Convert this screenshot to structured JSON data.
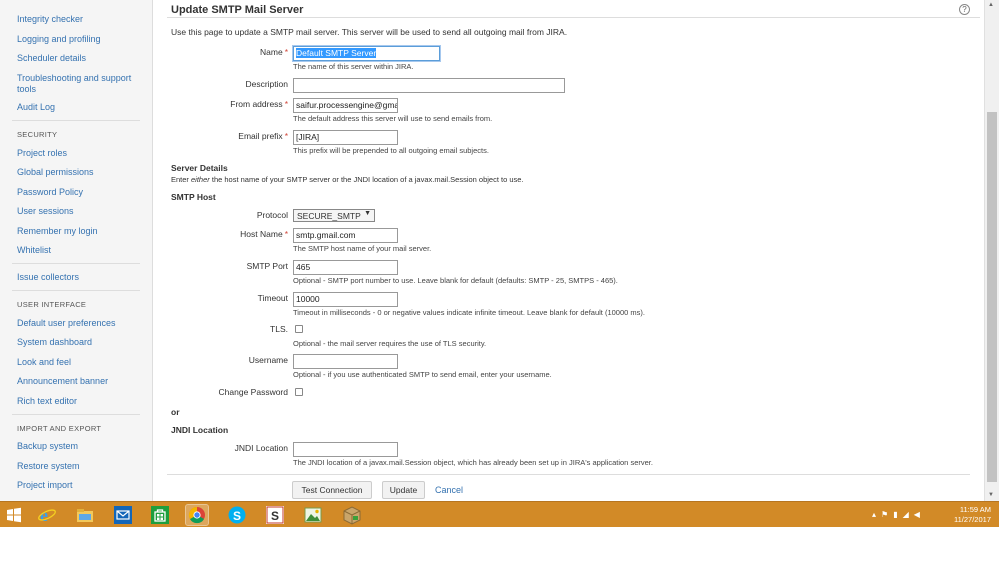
{
  "sidebar": {
    "items_top": [
      "Integrity checker",
      "Logging and profiling",
      "Scheduler details",
      "Troubleshooting and support tools",
      "Audit Log"
    ],
    "security_heading": "SECURITY",
    "security_items": [
      "Project roles",
      "Global permissions",
      "Password Policy",
      "User sessions",
      "Remember my login",
      "Whitelist"
    ],
    "issue_collectors": "Issue collectors",
    "ui_heading": "USER INTERFACE",
    "ui_items": [
      "Default user preferences",
      "System dashboard",
      "Look and feel",
      "Announcement banner",
      "Rich text editor"
    ],
    "import_heading": "IMPORT AND EXPORT",
    "import_items": [
      "Backup system",
      "Restore system",
      "Project import"
    ]
  },
  "page": {
    "title": "Update SMTP Mail Server",
    "description": "Use this page to update a SMTP mail server. This server will be used to send all outgoing mail from JIRA."
  },
  "form": {
    "name": {
      "label": "Name",
      "value": "Default SMTP Server",
      "hint": "The name of this server within JIRA."
    },
    "description": {
      "label": "Description",
      "value": ""
    },
    "from_address": {
      "label": "From address",
      "value": "saifur.processengine@gmail.com",
      "hint": "The default address this server will use to send emails from."
    },
    "email_prefix": {
      "label": "Email prefix",
      "value": "[JIRA]",
      "hint": "This prefix will be prepended to all outgoing email subjects."
    },
    "server_details": {
      "heading": "Server Details",
      "text_pre": "Enter ",
      "text_em": "either",
      "text_post": " the host name of your SMTP server or the JNDI location of a javax.mail.Session object to use."
    },
    "smtp_host_heading": "SMTP Host",
    "protocol": {
      "label": "Protocol",
      "value": "SECURE_SMTP"
    },
    "host_name": {
      "label": "Host Name",
      "value": "smtp.gmail.com",
      "hint": "The SMTP host name of your mail server."
    },
    "smtp_port": {
      "label": "SMTP Port",
      "value": "465",
      "hint": "Optional - SMTP port number to use. Leave blank for default (defaults: SMTP - 25, SMTPS - 465)."
    },
    "timeout": {
      "label": "Timeout",
      "value": "10000",
      "hint": "Timeout in milliseconds - 0 or negative values indicate infinite timeout. Leave blank for default (10000 ms)."
    },
    "tls": {
      "label": "TLS.",
      "checked": false,
      "hint": "Optional - the mail server requires the use of TLS security."
    },
    "username": {
      "label": "Username",
      "value": "",
      "hint": "Optional - if you use authenticated SMTP to send email, enter your username."
    },
    "change_password": {
      "label": "Change Password",
      "checked": false
    },
    "or_text": "or",
    "jndi_heading": "JNDI Location",
    "jndi_location": {
      "label": "JNDI Location",
      "value": "",
      "hint": "The JNDI location of a javax.mail.Session object, which has already been set up in JIRA's application server."
    },
    "buttons": {
      "test": "Test Connection",
      "update": "Update",
      "cancel": "Cancel"
    }
  },
  "taskbar": {
    "time": "11:59 AM",
    "date": "11/27/2017",
    "apps": [
      "start-windows-icon",
      "internet-explorer-icon",
      "file-explorer-icon",
      "mail-icon",
      "store-icon",
      "chrome-icon",
      "skype-icon",
      "slides-app-icon",
      "image-app-icon",
      "package-app-icon"
    ]
  },
  "colors": {
    "link": "#3572b0",
    "required": "#d04437",
    "taskbar": "#d28a27",
    "selection": "#3399ff"
  }
}
